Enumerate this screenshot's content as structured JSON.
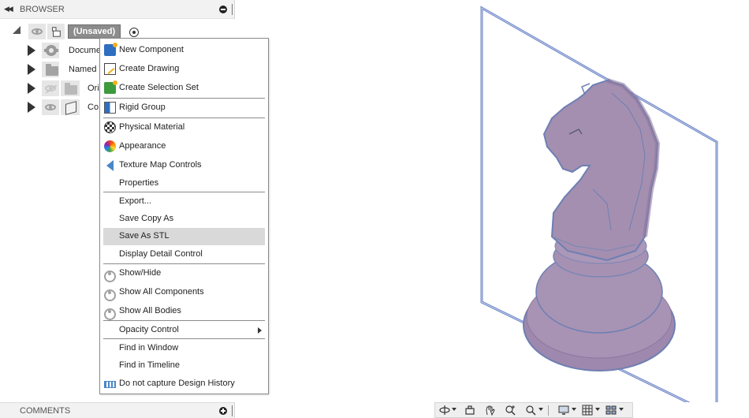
{
  "browser": {
    "title": "BROWSER",
    "root": {
      "name": "(Unsaved)"
    },
    "items": [
      {
        "label": "Document Settings",
        "visible_label": "Docume"
      },
      {
        "label": "Named Views",
        "visible_label": "Named V"
      },
      {
        "label": "Origin",
        "visible_label": "Ori"
      },
      {
        "label": "Components",
        "visible_label": "Co"
      }
    ]
  },
  "context_menu": {
    "items": [
      {
        "label": "New Component",
        "icon": "new-component-icon"
      },
      {
        "label": "Create Drawing",
        "icon": "create-drawing-icon"
      },
      {
        "label": "Create Selection Set",
        "icon": "selection-set-icon"
      },
      {
        "label": "Rigid Group",
        "icon": "rigid-group-icon"
      },
      {
        "label": "Physical Material",
        "icon": "physical-material-icon"
      },
      {
        "label": "Appearance",
        "icon": "appearance-icon"
      },
      {
        "label": "Texture Map Controls",
        "icon": "texture-map-icon"
      },
      {
        "label": "Properties",
        "icon": ""
      },
      {
        "label": "Export...",
        "icon": ""
      },
      {
        "label": "Save Copy As",
        "icon": ""
      },
      {
        "label": "Save As STL",
        "icon": "",
        "highlighted": true
      },
      {
        "label": "Display Detail Control",
        "icon": ""
      },
      {
        "label": "Show/Hide",
        "icon": "eye-icon"
      },
      {
        "label": "Show All Components",
        "icon": "eye-icon"
      },
      {
        "label": "Show All Bodies",
        "icon": "eye-icon"
      },
      {
        "label": "Opacity Control",
        "icon": "",
        "submenu": true
      },
      {
        "label": "Find in Window",
        "icon": ""
      },
      {
        "label": "Find in Timeline",
        "icon": ""
      },
      {
        "label": "Do not capture Design History",
        "icon": "design-history-icon"
      }
    ]
  },
  "comments": {
    "title": "COMMENTS"
  },
  "nav_toolbar": {
    "buttons": [
      "orbit-icon",
      "look-at-icon",
      "pan-icon",
      "zoom-icon",
      "fit-icon",
      "display-settings-icon",
      "grid-icon",
      "viewports-icon"
    ]
  },
  "model": {
    "name": "knight chess piece",
    "body_color": "#a48fb0",
    "edge_color": "#6e7fb3",
    "plane_color": "#6a83c4"
  }
}
